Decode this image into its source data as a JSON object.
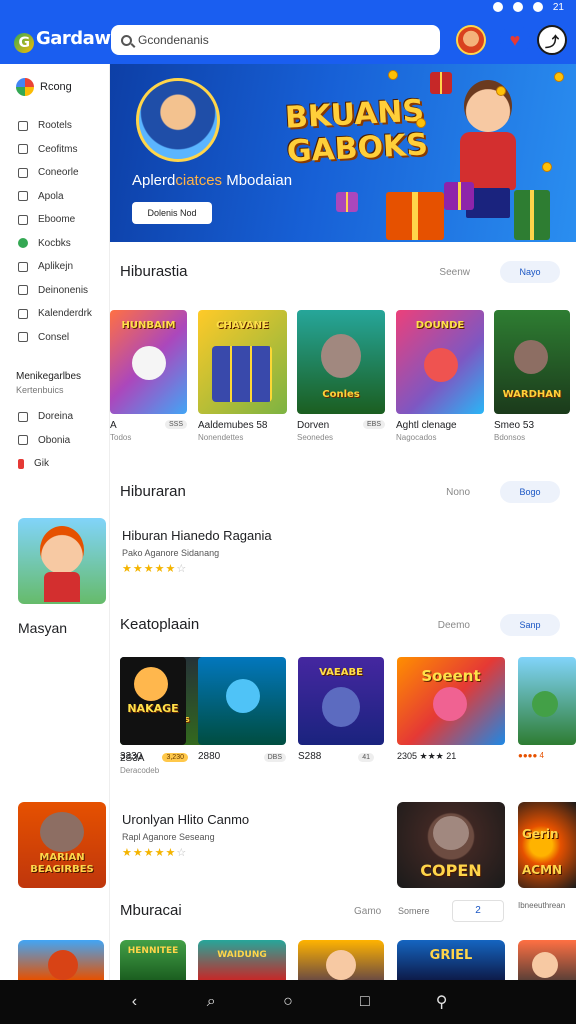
{
  "status_bar": {
    "time": "21"
  },
  "app": {
    "logo_text": "Gardaw",
    "search_placeholder": "Gcondenanis"
  },
  "sidebar": {
    "header": "Rcong",
    "items": [
      {
        "label": "Rootels",
        "icon": "home-icon"
      },
      {
        "label": "Ceofitms",
        "icon": "pin-icon"
      },
      {
        "label": "Coneorle",
        "icon": "clock-icon"
      },
      {
        "label": "Apola",
        "icon": "location-icon"
      },
      {
        "label": "Eboome",
        "icon": "bookmark-icon"
      },
      {
        "label": "Kocbks",
        "icon": "green-dot-icon"
      },
      {
        "label": "Aplikejn",
        "icon": "gear-icon"
      },
      {
        "label": "Deinonenis",
        "icon": "document-icon"
      },
      {
        "label": "Kalenderdrk",
        "icon": "calendar-icon"
      },
      {
        "label": "Consel",
        "icon": "settings-icon"
      }
    ],
    "section_title": "Menikegarlbes",
    "section_subtitle": "Kertenbuics",
    "items2": [
      {
        "label": "Doreina",
        "icon": "globe-icon"
      },
      {
        "label": "Obonia",
        "icon": "info-icon"
      },
      {
        "label": "Gik",
        "icon": "flag-icon"
      }
    ]
  },
  "banner": {
    "title_line1": "BKUANS",
    "title_line2": "GABOKS",
    "subtitle_a": "Aplerd",
    "subtitle_b": "ciatces",
    "subtitle_c": " Mbodaian",
    "button": "Dolenis Nod"
  },
  "section1": {
    "title": "Hiburastia",
    "more": "Seenw",
    "pill": "Nayo",
    "cards": [
      {
        "name": "A",
        "tag": "SSS",
        "meta": "Todos",
        "art": "HUNBAIM"
      },
      {
        "name": "Aaldemubes 58",
        "tag": "",
        "meta": "Nonendettes",
        "art": "CHAVANE"
      },
      {
        "name": "Dorven",
        "tag": "EBS",
        "meta": "Seonedes",
        "art": "Conles"
      },
      {
        "name": "Aghtl clenage",
        "tag": "",
        "meta": "Nagocados",
        "art": "DOUNDE"
      },
      {
        "name": "Smeo 53",
        "tag": "",
        "meta": "Bdonsos",
        "art": "WARDHAN"
      }
    ]
  },
  "section2": {
    "title": "Hiburaran",
    "more": "Nono",
    "pill": "Bogo"
  },
  "featured1": {
    "title": "Hiburan Hianedo Ragania",
    "subtitle": "Pako Aganore Sidanang",
    "stars": "★★★★★",
    "star_off": "☆"
  },
  "side_label": "Masyan",
  "section3": {
    "title": "Keatoplaain",
    "more": "Deemo",
    "pill": "Sanp",
    "cards": [
      {
        "name": "2S3A",
        "tag": "",
        "meta": "Deracodeb",
        "art": "Chabaeres"
      },
      {
        "name": "3330",
        "tag": "3,230",
        "meta": "",
        "art": "NAKAGE"
      },
      {
        "name": "2880",
        "tag": "DBS",
        "meta": "",
        "art": ""
      },
      {
        "name": "S288",
        "tag": "41",
        "meta": "",
        "art": "VAEABE"
      },
      {
        "name": "2305 ★★★ 21",
        "tag": "",
        "meta": "",
        "art": "Soeent"
      },
      {
        "name": "●●●● 4",
        "tag": "",
        "meta": "",
        "art": ""
      }
    ]
  },
  "featured2": {
    "title": "Uronlyan Hlito Canmo",
    "subtitle": "Rapl Aganore Seseang",
    "stars": "★★★★★",
    "star_off": "☆",
    "art": "MARIAN BEAGIRBES",
    "promo_art": "COPEN",
    "promo2_art": "Gerin ACMN",
    "promo2_meta": "Ibneeuthrean"
  },
  "section4": {
    "title": "Mburacai",
    "more": "Gamo",
    "sub": "Somere",
    "pill_icon": "2",
    "cards": [
      {
        "art": ""
      },
      {
        "art": "HENNITEE"
      },
      {
        "art": "WAIDUNG"
      },
      {
        "art": ""
      },
      {
        "art": "GRIEL"
      },
      {
        "art": ""
      }
    ]
  },
  "nav": {
    "back": "‹",
    "search": "⌕",
    "home": "○",
    "recent": "□",
    "assistant": "⚲"
  },
  "colors": {
    "primary": "#1a5ef0",
    "star": "#f4b400",
    "nav_bg": "#0a0a0a"
  }
}
